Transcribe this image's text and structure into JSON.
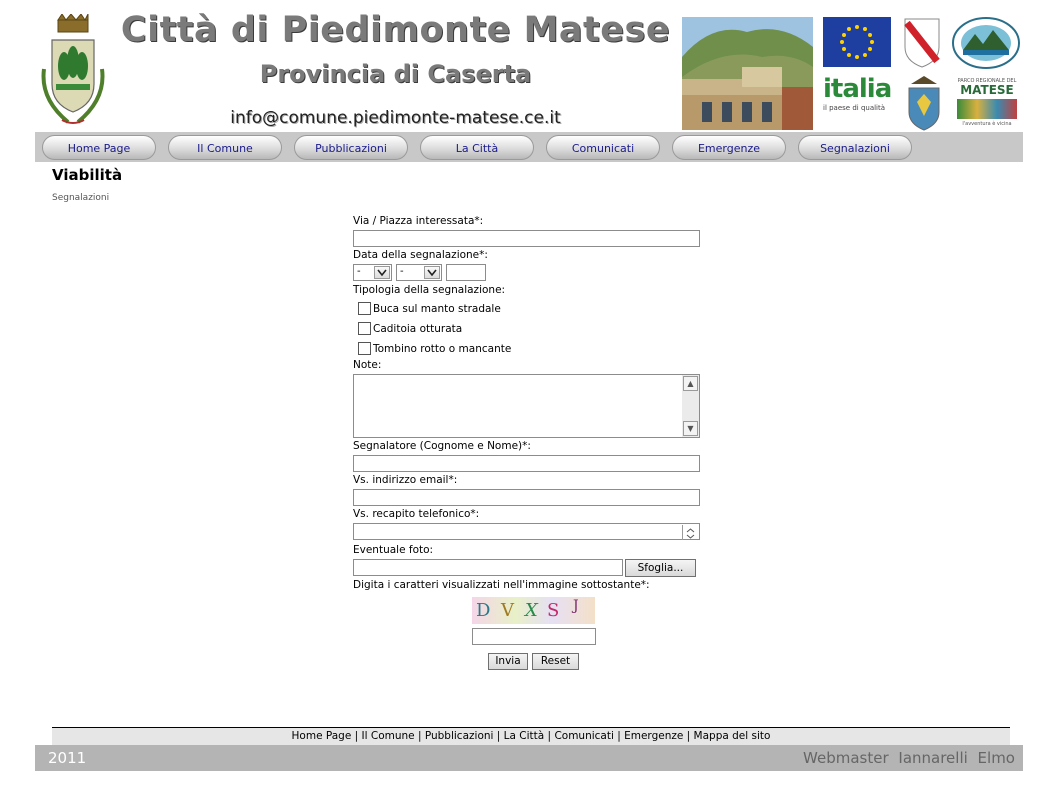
{
  "header": {
    "title": "Città di Piedimonte Matese",
    "subtitle": "Provincia di Caserta",
    "email": "info@comune.piedimonte-matese.ce.it",
    "logos": {
      "eu": "eu-flag-icon",
      "campania": "campania-region-icon",
      "comunita_montana": "comunita-montana-icon",
      "italia_text": "italia",
      "italia_tagline": "il paese di qualità",
      "provincia": "provincia-caserta-icon",
      "matese_text": "MATESE",
      "matese_top": "PARCO REGIONALE DEL",
      "matese_tagline": "l'avventura è vicina"
    }
  },
  "nav": {
    "items": [
      "Home Page",
      "Il Comune",
      "Pubblicazioni",
      "La Città",
      "Comunicati",
      "Emergenze",
      "Segnalazioni"
    ]
  },
  "page": {
    "title": "Viabilità",
    "breadcrumb": "Segnalazioni"
  },
  "form": {
    "street_label": "Via / Piazza interessata*:",
    "street_value": "",
    "date_label": "Data della segnalazione*:",
    "date_day": "-",
    "date_month": "-",
    "date_year": "",
    "type_label": "Tipologia della segnalazione:",
    "types": [
      "Buca sul manto stradale",
      "Caditoia otturata",
      "Tombino rotto o mancante"
    ],
    "notes_label": "Note:",
    "notes_value": "",
    "reporter_label": "Segnalatore (Cognome e Nome)*:",
    "reporter_value": "",
    "email_label": "Vs. indirizzo email*:",
    "email_value": "",
    "phone_label": "Vs. recapito telefonico*:",
    "phone_value": "",
    "photo_label": "Eventuale foto:",
    "browse_label": "Sfoglia...",
    "captcha_label": "Digita i caratteri visualizzati nell'immagine sottostante*:",
    "captcha_chars": [
      "D",
      "V",
      "X",
      "S",
      "J"
    ],
    "captcha_value": "",
    "submit_label": "Invia",
    "reset_label": "Reset"
  },
  "footer": {
    "links": [
      "Home Page",
      "Il Comune",
      "Pubblicazioni",
      "La Città",
      "Comunicati",
      "Emergenze",
      "Mappa del sito"
    ],
    "year": "2011",
    "credit": "Webmaster Iannarelli Elmo"
  },
  "colors": {
    "nav_bg": "#c8c8c8",
    "nav_text": "#1a1a8c",
    "footer_bar": "#b4b4b4",
    "title_gray": "#7a7a7a"
  }
}
